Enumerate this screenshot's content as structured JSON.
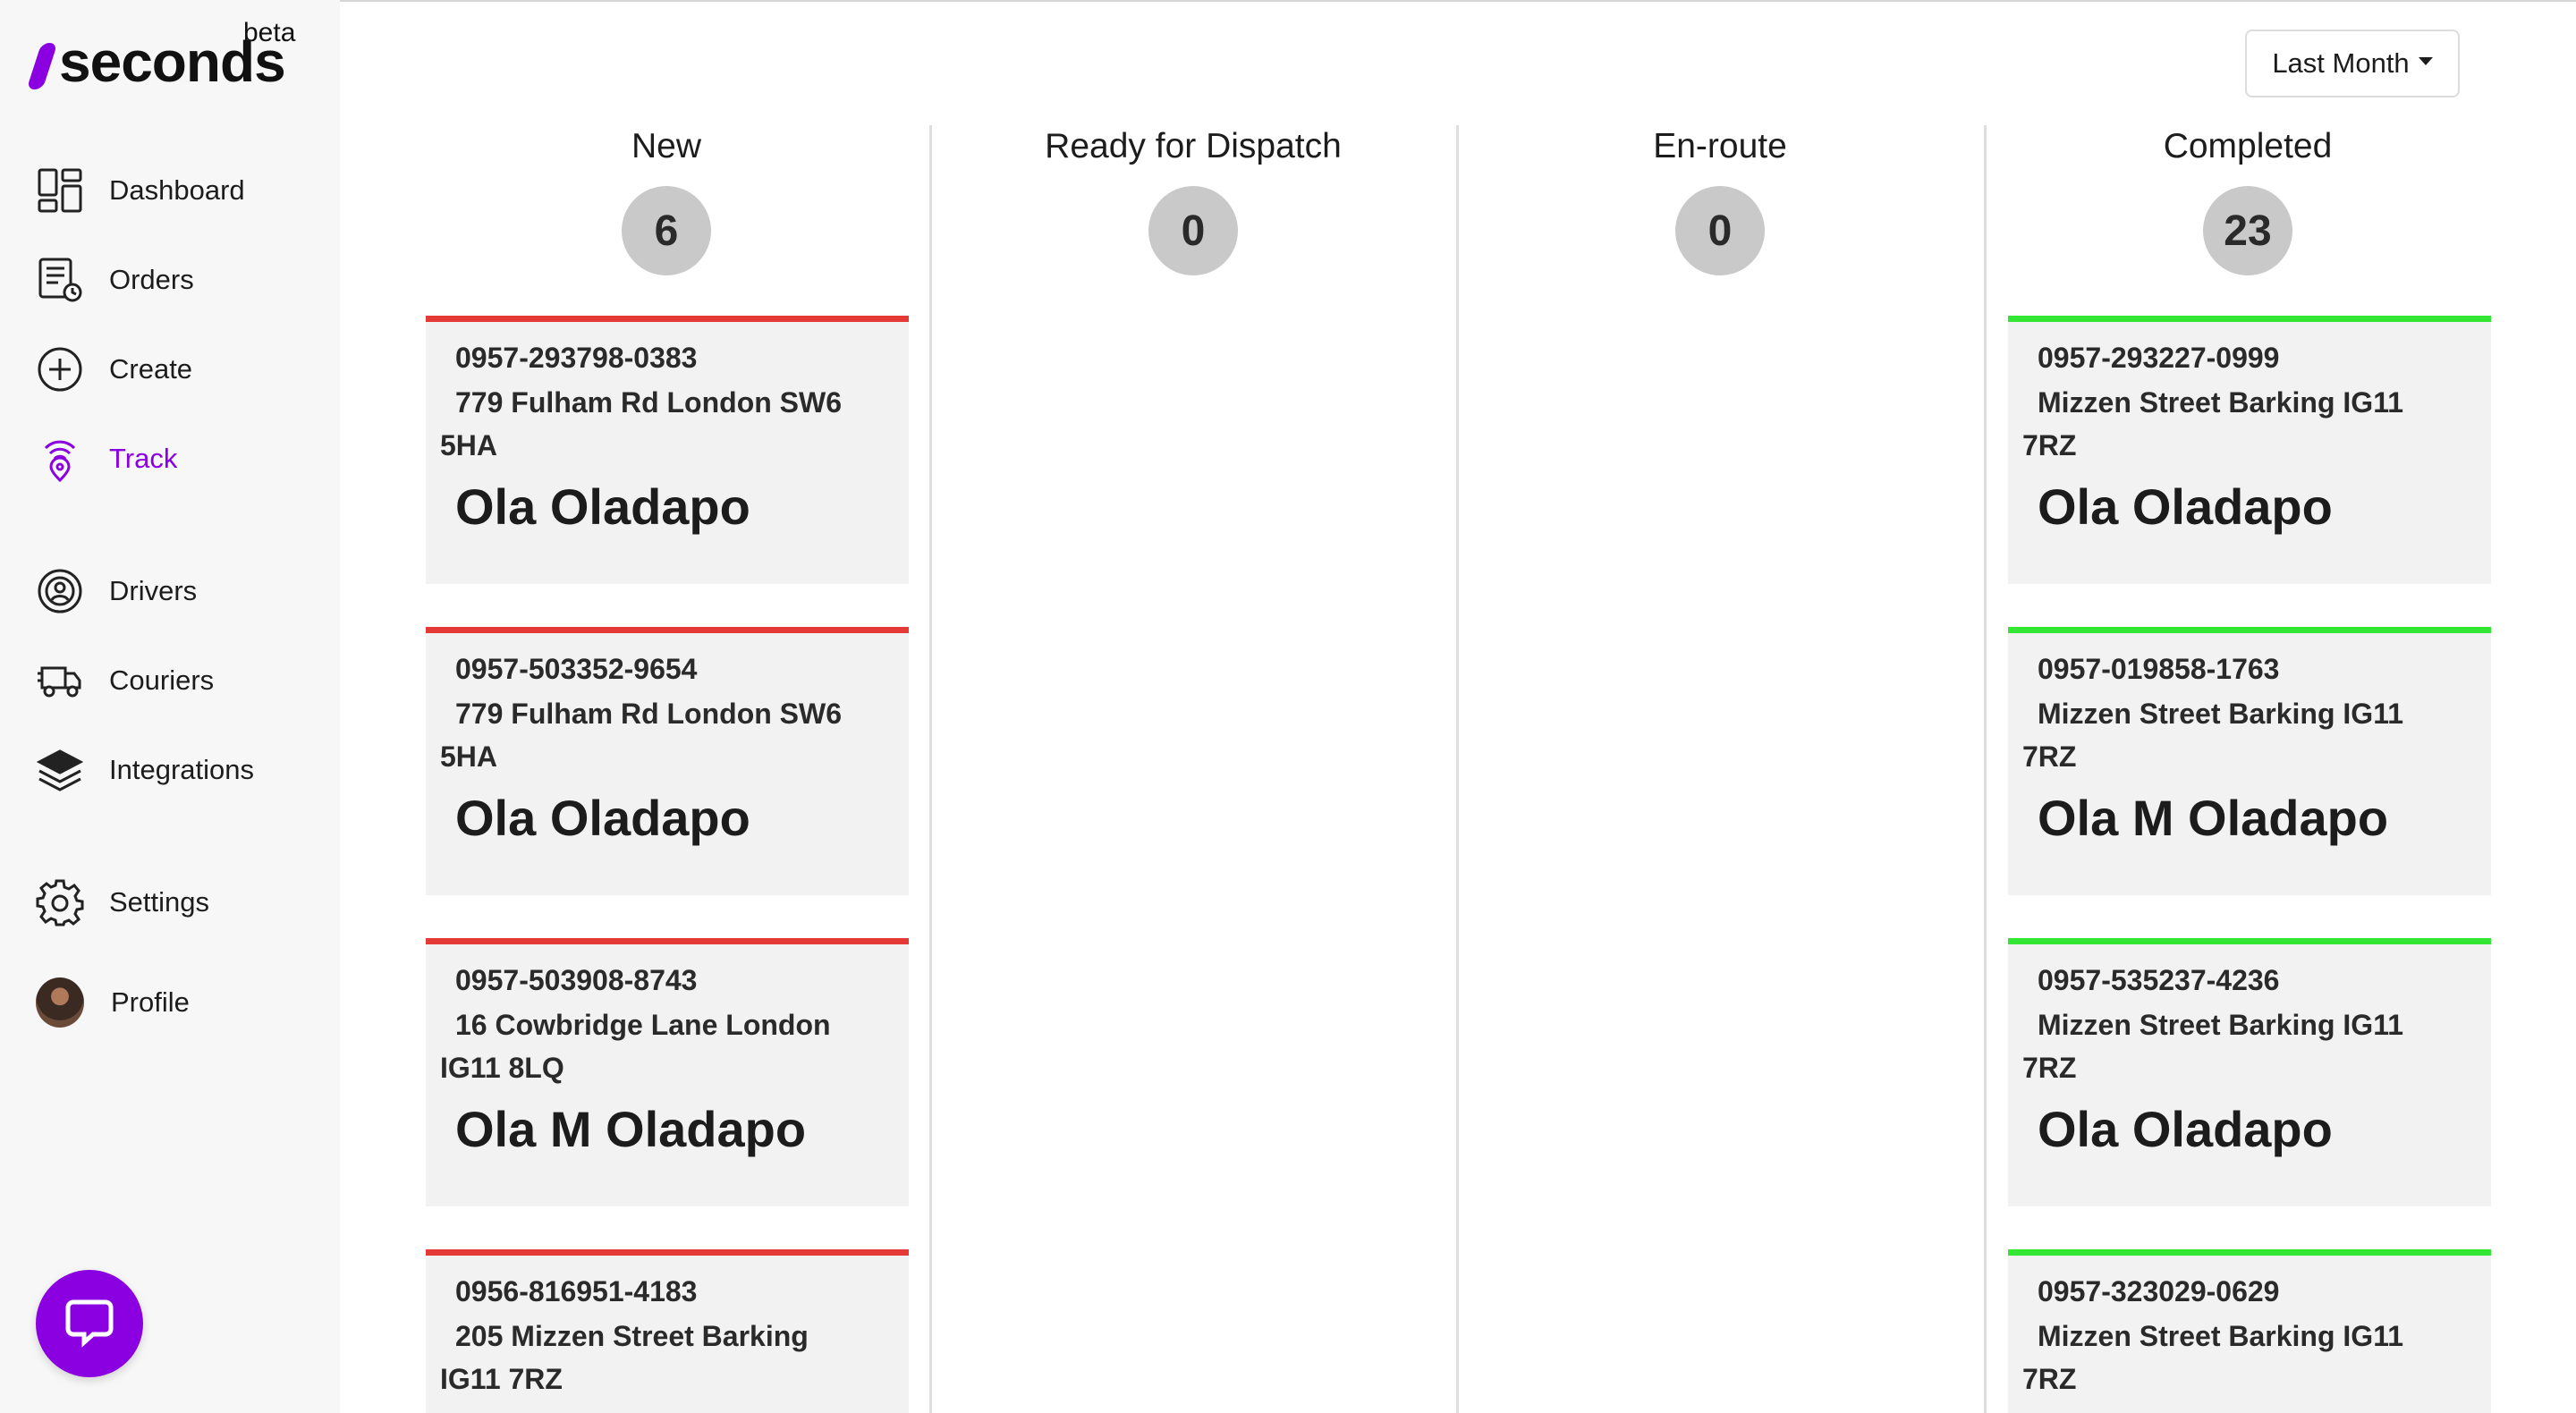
{
  "brand": {
    "name": "seconds",
    "tag": "beta",
    "accent": "#8b00e0"
  },
  "sidebar": {
    "items": [
      {
        "label": "Dashboard",
        "icon": "dashboard-icon"
      },
      {
        "label": "Orders",
        "icon": "orders-icon"
      },
      {
        "label": "Create",
        "icon": "plus-circle-icon"
      },
      {
        "label": "Track",
        "icon": "track-icon",
        "active": true
      },
      {
        "label": "Drivers",
        "icon": "steering-wheel-icon"
      },
      {
        "label": "Couriers",
        "icon": "truck-icon"
      },
      {
        "label": "Integrations",
        "icon": "layers-icon"
      },
      {
        "label": "Settings",
        "icon": "gear-icon"
      },
      {
        "label": "Profile",
        "icon": "avatar"
      }
    ],
    "chat_icon": "chat-icon"
  },
  "filter": {
    "label": "Last Month"
  },
  "columns": [
    {
      "title": "New",
      "count": "6",
      "status_color": "#e53935",
      "cards": [
        {
          "id": "0957-293798-0383",
          "address": "779 Fulham Rd London SW6 5HA",
          "name": "Ola Oladapo"
        },
        {
          "id": "0957-503352-9654",
          "address": "779 Fulham Rd London SW6 5HA",
          "name": "Ola Oladapo"
        },
        {
          "id": "0957-503908-8743",
          "address": "16 Cowbridge Lane London IG11 8LQ",
          "name": "Ola M Oladapo"
        },
        {
          "id": "0956-816951-4183",
          "address": "205 Mizzen Street Barking IG11 7RZ",
          "name": ""
        }
      ]
    },
    {
      "title": "Ready for Dispatch",
      "count": "0",
      "cards": []
    },
    {
      "title": "En-route",
      "count": "0",
      "cards": []
    },
    {
      "title": "Completed",
      "count": "23",
      "status_color": "#33e633",
      "cards": [
        {
          "id": "0957-293227-0999",
          "address": "Mizzen Street Barking IG11 7RZ",
          "name": "Ola Oladapo"
        },
        {
          "id": "0957-019858-1763",
          "address": "Mizzen Street Barking IG11 7RZ",
          "name": "Ola M Oladapo"
        },
        {
          "id": "0957-535237-4236",
          "address": "Mizzen Street Barking IG11 7RZ",
          "name": "Ola Oladapo"
        },
        {
          "id": "0957-323029-0629",
          "address": "Mizzen Street Barking IG11 7RZ",
          "name": ""
        }
      ]
    }
  ]
}
